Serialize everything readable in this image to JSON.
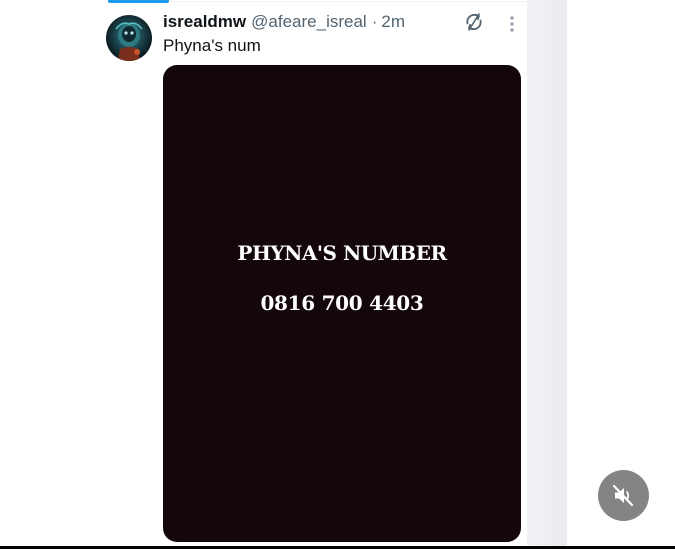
{
  "post": {
    "display_name": "isrealdmw",
    "handle": "@afeare_isreal",
    "separator": "·",
    "time": "2m",
    "text": "Phyna's num"
  },
  "media": {
    "title": "PHYNA'S NUMBER",
    "number": "0816 700 4403",
    "background_color": "#140709"
  },
  "icons": {
    "sync": "sync-icon",
    "more": "more-vertical-icon",
    "mute": "volume-muted-icon"
  },
  "colors": {
    "accent": "#1d9bf0",
    "primary_text": "#0f1419",
    "secondary_text": "#536471"
  }
}
